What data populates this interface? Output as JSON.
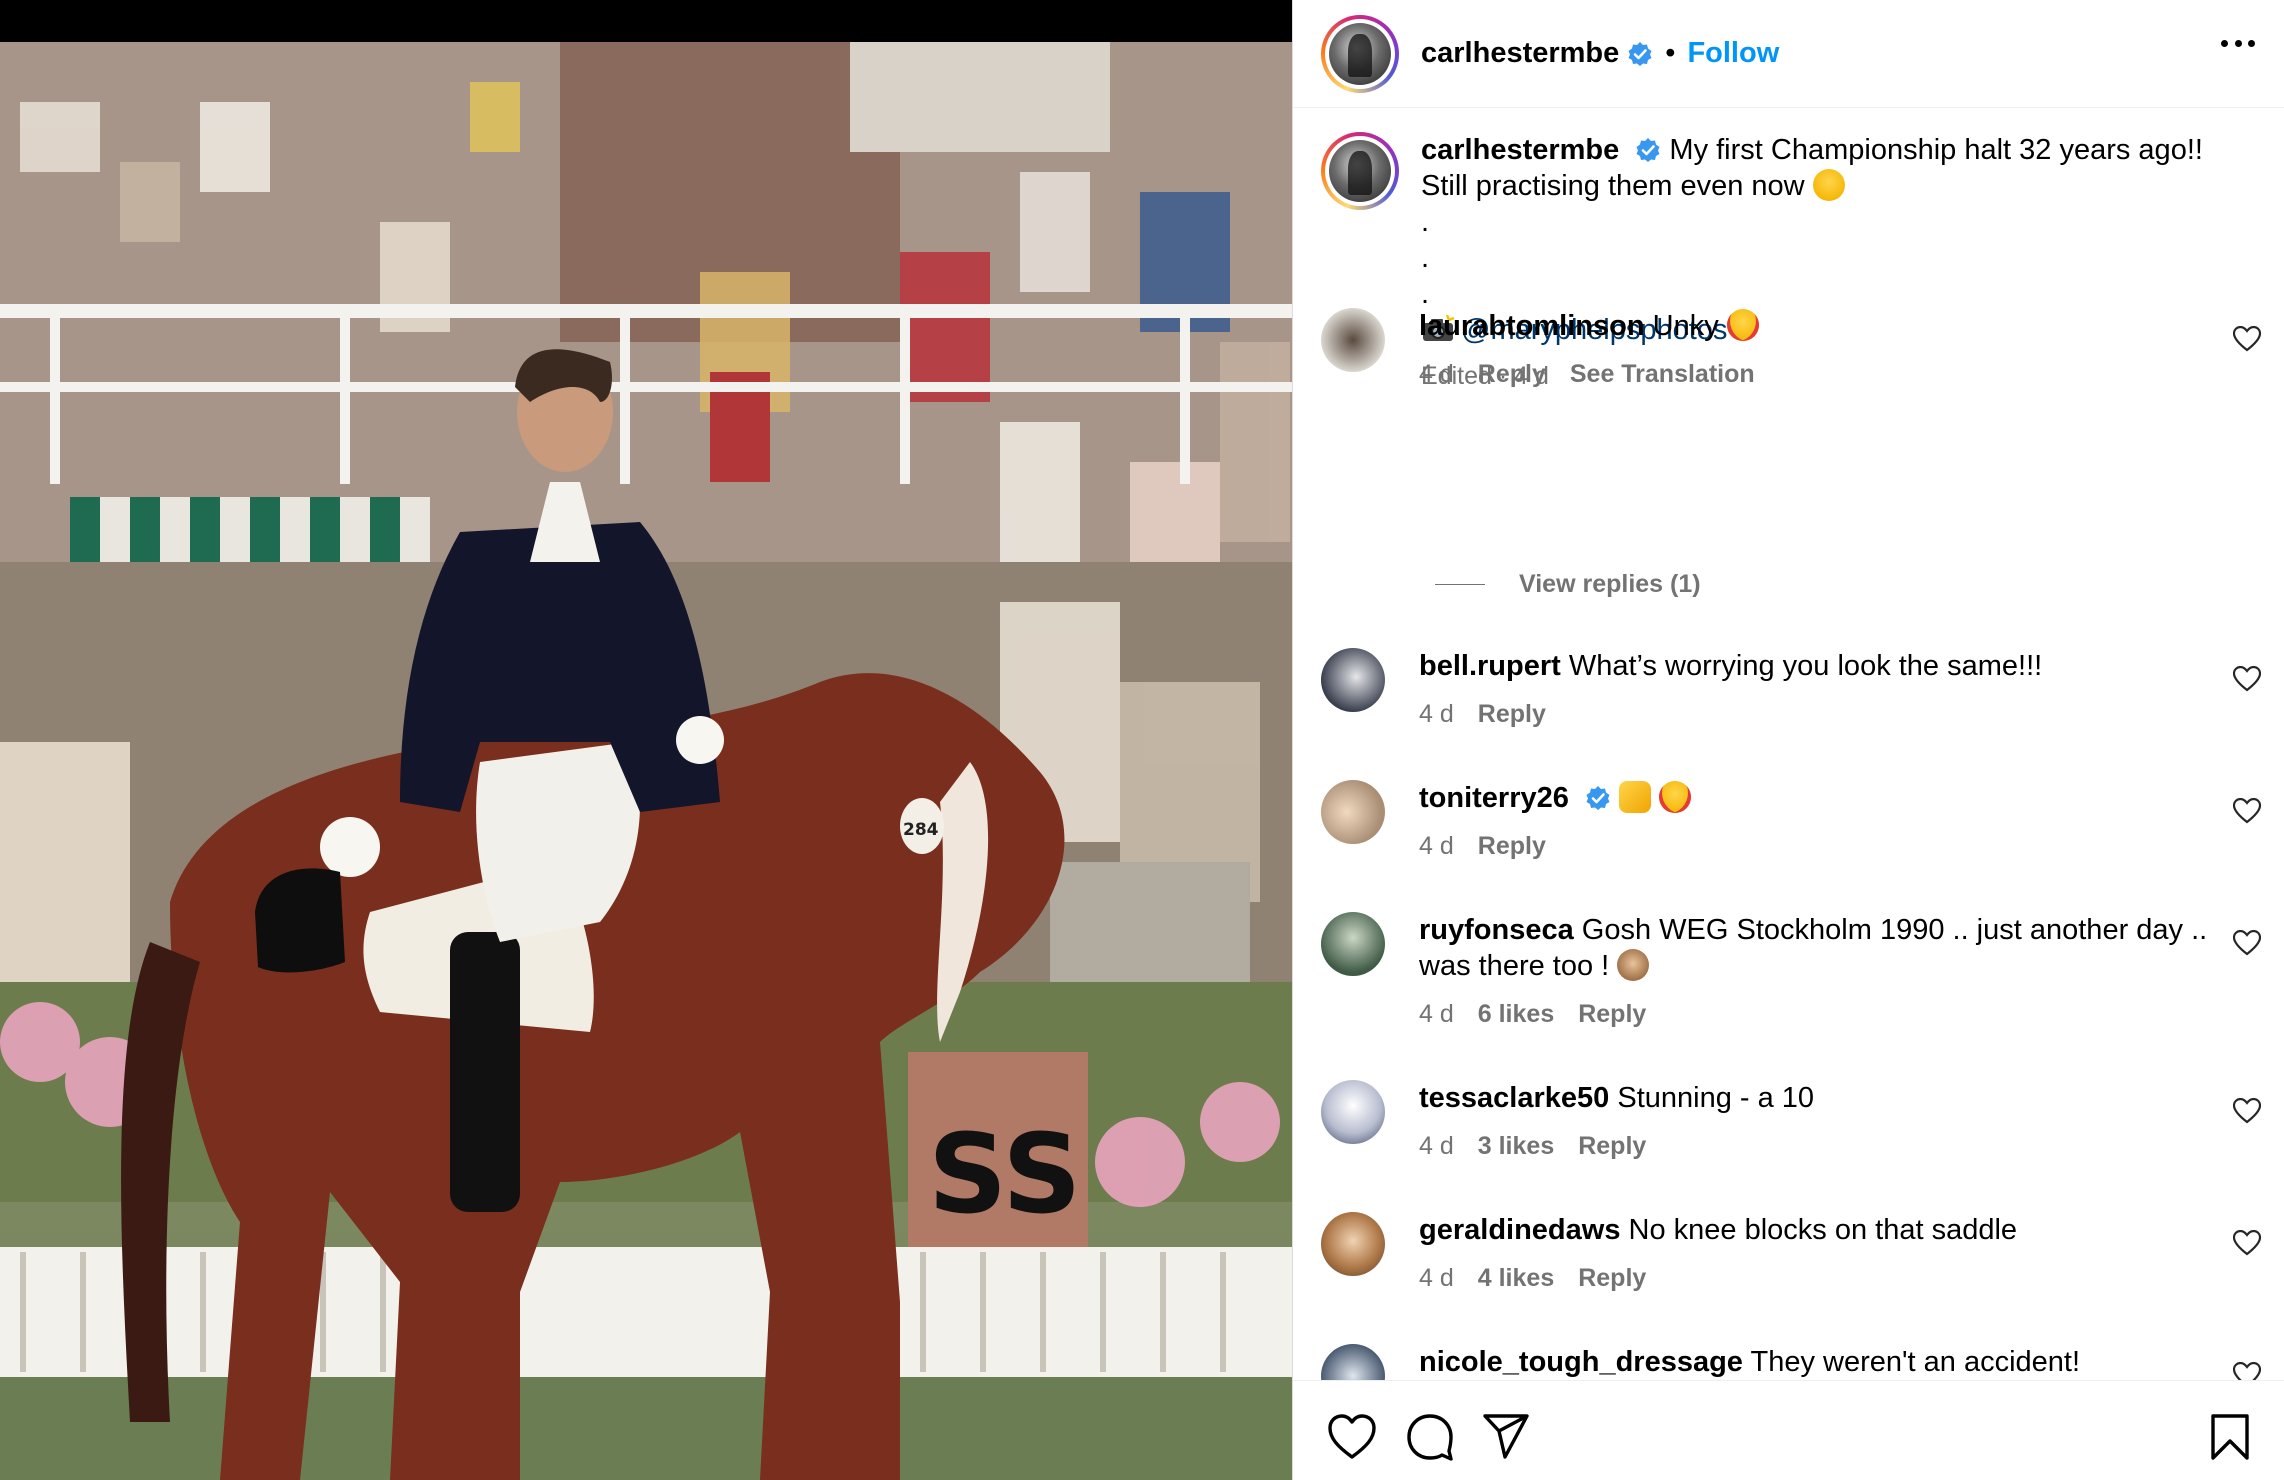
{
  "post": {
    "username": "carlhestermbe",
    "separator": "•",
    "follow_label": "Follow"
  },
  "caption": {
    "username": "carlhestermbe",
    "line1": "My first Championship halt 32 years ago!!",
    "line2": "Still practising them even now",
    "dot": ".",
    "camera_icon": "camera-flash-icon",
    "mention": "@maryphelpsphotos",
    "meta": "Edited · 4 d"
  },
  "comments": [
    {
      "username": "laurabtomlinson",
      "text": "Unky",
      "emoji": "heart-eyes",
      "age": "4 d",
      "likes": "",
      "reply": "Reply",
      "translate": "See Translation",
      "verified": false
    },
    {
      "username": "bell.rupert",
      "text": "What’s worrying you look the same!!!",
      "age": "4 d",
      "likes": "",
      "reply": "Reply",
      "verified": false
    },
    {
      "username": "toniterry26",
      "text": "",
      "emoji": "raised-hands heart-eyes",
      "age": "4 d",
      "likes": "",
      "reply": "Reply",
      "verified": true
    },
    {
      "username": "ruyfonseca",
      "text": "Gosh WEG Stockholm 1990 .. just another day ..",
      "text2": "was there too !",
      "emoji": "see-no-evil-monkey",
      "age": "4 d",
      "likes": "6 likes",
      "reply": "Reply",
      "verified": false
    },
    {
      "username": "tessaclarke50",
      "text": "Stunning - a 10",
      "age": "4 d",
      "likes": "3 likes",
      "reply": "Reply",
      "verified": false
    },
    {
      "username": "geraldinedaws",
      "text": "No knee blocks on that saddle",
      "age": "4 d",
      "likes": "4 likes",
      "reply": "Reply",
      "verified": false
    },
    {
      "username": "nicole_tough_dressage",
      "text": "They weren't an accident!",
      "age": "",
      "likes": "",
      "reply": "",
      "verified": false
    }
  ],
  "view_replies": "View replies (1)",
  "actions": {
    "icons": [
      "heart-icon",
      "comment-icon",
      "share-icon",
      "bookmark-icon"
    ]
  },
  "photo": {
    "bib_number": "284",
    "letter_marker": "SS"
  },
  "colors": {
    "accent": "#0095f6",
    "mention": "#00376b",
    "muted": "#737373",
    "verified": "#3897f0"
  }
}
